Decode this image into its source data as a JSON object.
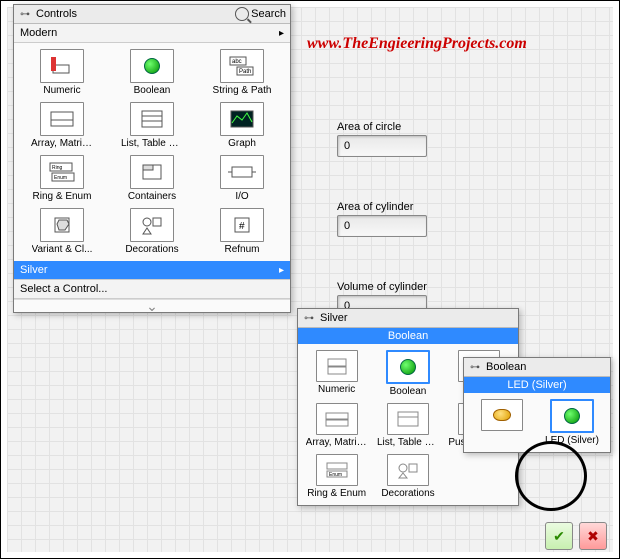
{
  "watermark": "www.TheEngieeringProjects.com",
  "indicators": [
    {
      "label": "Area of circle",
      "value": "0"
    },
    {
      "label": "Area of cylinder",
      "value": "0"
    },
    {
      "label": "Volume of cylinder",
      "value": "0"
    }
  ],
  "controls_palette": {
    "title": "Controls",
    "search_label": "Search",
    "category_label": "Modern",
    "items": [
      "Numeric",
      "Boolean",
      "String & Path",
      "Array, Matrix...",
      "List, Table & ...",
      "Graph",
      "Ring & Enum",
      "Containers",
      "I/O",
      "Variant & Cl...",
      "Decorations",
      "Refnum"
    ],
    "highlighted_row": "Silver",
    "extra_row": "Select a Control..."
  },
  "silver_palette": {
    "title": "Silver",
    "category_bar": "Boolean",
    "items": [
      "Numeric",
      "Boolean",
      "",
      "Array, Matrix...",
      "List, Table & ...",
      "Push Button ...",
      "Ring & Enum",
      "Decorations",
      ""
    ]
  },
  "boolean_palette": {
    "title": "Boolean",
    "category_bar": "LED (Silver)",
    "items": [
      "",
      "LED (Silver)"
    ]
  }
}
